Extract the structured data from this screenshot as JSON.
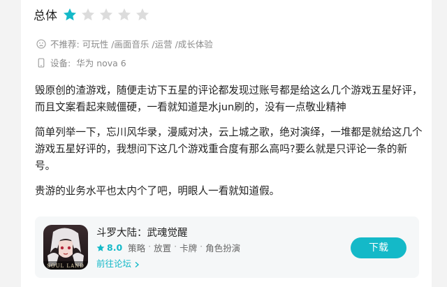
{
  "rating": {
    "label": "总体",
    "value": 1,
    "max": 5,
    "filled_color": "#14b9c8",
    "empty_color": "#dcdcdc"
  },
  "recommendation": {
    "prefix": "不推荐:",
    "tags": [
      "可玩性",
      "画面音乐",
      "运营",
      "成长体验"
    ],
    "separator": " /",
    "icon": "frown-face-icon"
  },
  "device": {
    "label": "设备:",
    "value": "华为 nova 6",
    "icon": "phone-icon"
  },
  "review": {
    "paragraphs": [
      "毁原创的渣游戏，随便走访下五星的评论都发现过账号都是给这么几个游戏五星好评，而且文案看起来贼僵硬，一看就知道是水jun刷的，没有一点敬业精神",
      "简单列举一下，忘川风华录，漫威对决，云上城之歌，绝对演绎，一堆都是就给这几个游戏五星好评的，我想问下这几个游戏重合度有那么高吗?要么就是只评论一条的新号。",
      "贵游的业务水平也太内个了吧，明眼人一看就知道假。"
    ]
  },
  "game": {
    "title": "斗罗大陆：武魂觉醒",
    "score": "8.0",
    "tags": [
      "策略",
      "放置",
      "卡牌",
      "角色扮演"
    ],
    "tag_separator": "·",
    "forum_link": "前往论坛",
    "download_label": "下载",
    "icon_logo_text": "SOUL LAND",
    "accent_color": "#14b9c8"
  }
}
